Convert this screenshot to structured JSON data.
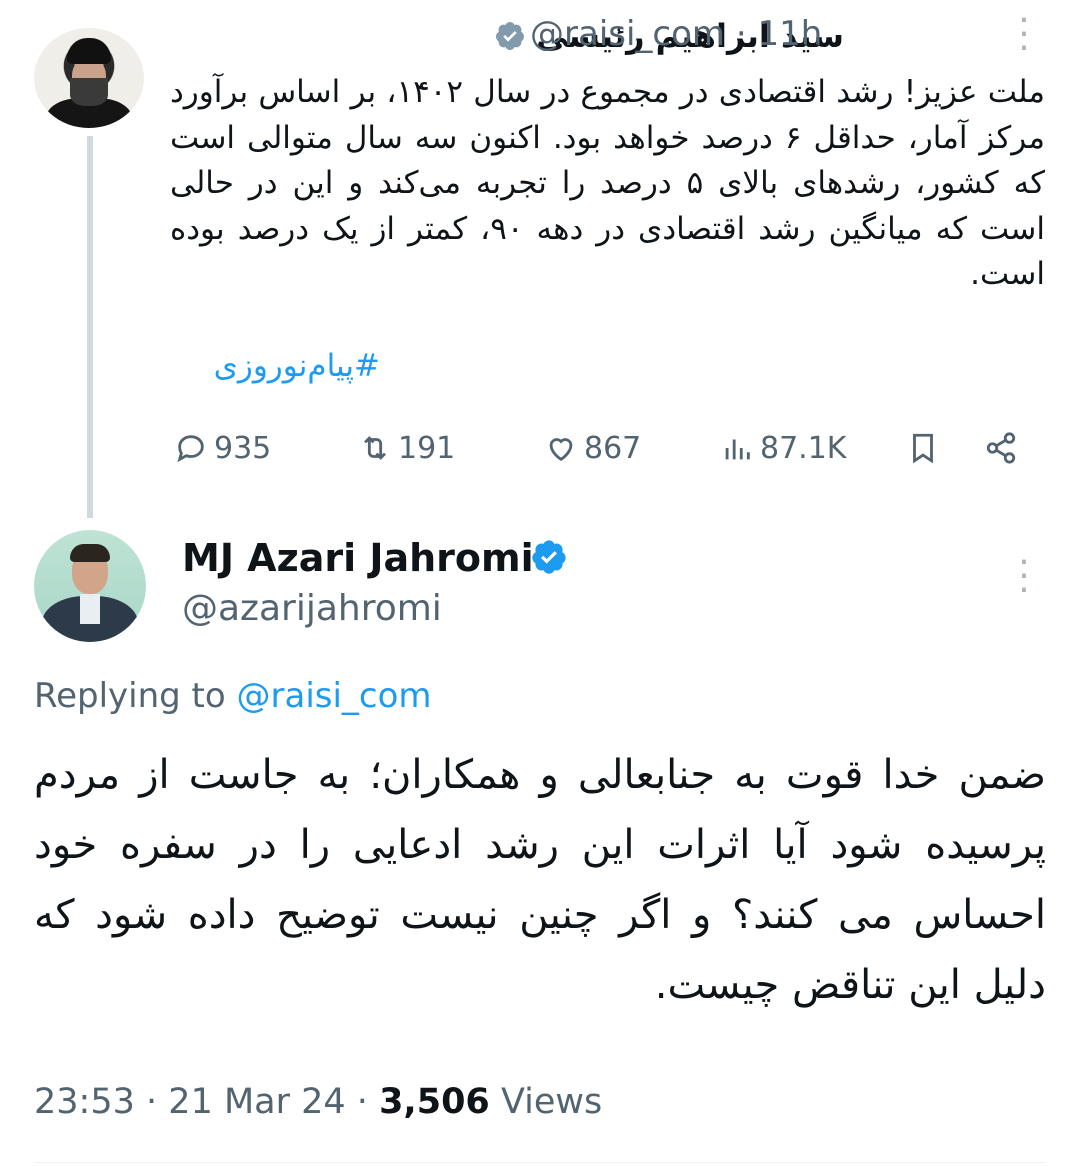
{
  "first_tweet": {
    "author_name": "سید ابراهیم رئیسی",
    "handle": "@raisi_com",
    "separator": "·",
    "time": "11h",
    "text": "ملت عزیز! رشد اقتصادی در مجموع در سال ۱۴۰۲، بر اساس برآورد مرکز آمار، حداقل ۶ درصد خواهد بود. اکنون سه سال متوالی است که کشور، رشدهای بالای ۵ درصد را تجربه می‌کند و این در حالی است که میانگین رشد اقتصادی در دهه ۹۰، کمتر از یک درصد بوده است.",
    "hashtag": "#پیام‌نوروزی",
    "actions": {
      "replies": "935",
      "retweets": "191",
      "likes": "867",
      "views": "87.1K"
    },
    "icons": [
      "reply-icon",
      "retweet-icon",
      "like-icon",
      "views-icon",
      "bookmark-icon",
      "share-icon",
      "more-icon",
      "verified-gray-icon"
    ]
  },
  "second_tweet": {
    "author_name": "MJ Azari Jahromi",
    "handle": "@azarijahromi",
    "replying_prefix": "Replying to",
    "replying_to": "@raisi_com",
    "text": "ضمن خدا قوت به جنابعالی و همکاران؛ به جاست از مردم پرسیده شود آیا اثرات این رشد ادعایی را در سفره خود احساس می کنند؟ و اگر چنین نیست توضیح داده شود که دلیل این تناقض چیست.",
    "time": "23:53",
    "date": "21 Mar 24",
    "separator": "·",
    "views_count": "3,506",
    "views_label": "Views",
    "icons": [
      "verified-blue-icon",
      "more-icon"
    ]
  },
  "colors": {
    "text": "#0f1419",
    "secondary": "#536471",
    "link": "#1d9bf0",
    "thread_line": "#cfd9de"
  }
}
